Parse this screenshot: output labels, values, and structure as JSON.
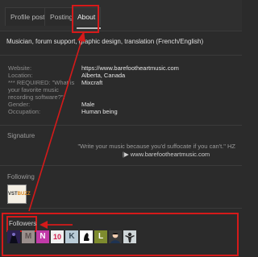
{
  "tabs": [
    {
      "label": "Profile posts"
    },
    {
      "label": "Postings"
    },
    {
      "label": "About"
    }
  ],
  "profile": {
    "bio": "Musician, forum support, graphic design, translation (French/English)",
    "fields": [
      {
        "label": "Website:",
        "value": "https://www.barefootheartmusic.com"
      },
      {
        "label": "Location:",
        "value": "Alberta, Canada"
      },
      {
        "label": "*** REQUIRED: \"What is your favorite music recording software?\":",
        "value": "Mixcraft"
      },
      {
        "label": "Gender:",
        "value": "Male"
      },
      {
        "label": "Occupation:",
        "value": "Human being"
      }
    ]
  },
  "signature": {
    "heading": "Signature",
    "quote": "\"Write your music because you'd suffocate if you can't.\" HZ",
    "link": "|▶ www.barefootheartmusic.com"
  },
  "following": {
    "heading": "Following",
    "items": [
      {
        "label_part1": "VST",
        "label_part2": "BUZZ"
      }
    ]
  },
  "followers": {
    "heading": "Followers",
    "items": [
      {
        "letter": "",
        "bg": "#2c2050",
        "fg": "#7a6cc2"
      },
      {
        "letter": "M",
        "bg": "#9a8f8c",
        "fg": "#5e5351"
      },
      {
        "letter": "N",
        "bg": "#c13aa8",
        "fg": "#ffffff"
      },
      {
        "letter": "10",
        "bg": "#f0f0f0",
        "fg": "#d01d4b"
      },
      {
        "letter": "K",
        "bg": "#b9cbd6",
        "fg": "#3d4f5c"
      },
      {
        "letter": "",
        "bg": "#ffffff",
        "fg": "#111111"
      },
      {
        "letter": "L",
        "bg": "#7e8b2e",
        "fg": "#ffffff"
      },
      {
        "letter": "",
        "bg": "#3a3a3a",
        "fg": "#f3cdb0"
      },
      {
        "letter": "",
        "bg": "#cfd6d8",
        "fg": "#2a2a2a"
      }
    ]
  },
  "colors": {
    "highlight": "#d51a1a",
    "background": "#2b2b2b"
  }
}
